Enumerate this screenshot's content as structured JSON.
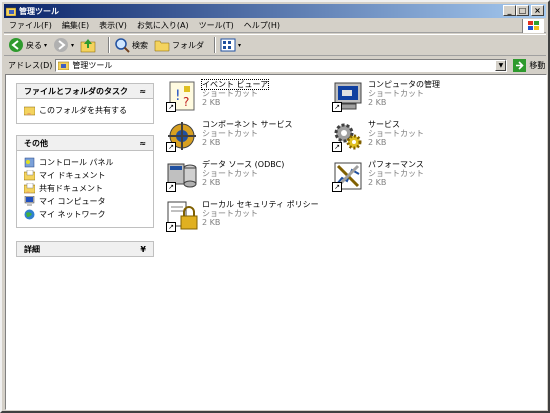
{
  "window": {
    "title": "管理ツール",
    "min": "_",
    "max": "□",
    "close": "×"
  },
  "menu": [
    "ファイル(F)",
    "編集(E)",
    "表示(V)",
    "お気に入り(A)",
    "ツール(T)",
    "ヘルプ(H)"
  ],
  "toolbar": {
    "back": "戻る",
    "search": "検索",
    "folders": "フォルダ"
  },
  "address": {
    "label": "アドレス(D)",
    "value": "管理ツール",
    "go": "移動"
  },
  "tasks": {
    "file_tasks": {
      "title": "ファイルとフォルダのタスク",
      "chev": "≈",
      "items": [
        "このフォルダを共有する"
      ]
    },
    "other": {
      "title": "その他",
      "chev": "≈",
      "items": [
        "コントロール パネル",
        "マイ ドキュメント",
        "共有ドキュメント",
        "マイ コンピュータ",
        "マイ ネットワーク"
      ]
    },
    "details": {
      "title": "詳細",
      "chev": "¥"
    }
  },
  "files": [
    {
      "name": "イベント ビューア",
      "type": "ショートカット",
      "size": "2 KB"
    },
    {
      "name": "コンピュータの管理",
      "type": "ショートカット",
      "size": "2 KB"
    },
    {
      "name": "コンポーネント サービス",
      "type": "ショートカット",
      "size": "2 KB"
    },
    {
      "name": "サービス",
      "type": "ショートカット",
      "size": "2 KB"
    },
    {
      "name": "データ ソース (ODBC)",
      "type": "ショートカット",
      "size": "2 KB"
    },
    {
      "name": "パフォーマンス",
      "type": "ショートカット",
      "size": "2 KB"
    },
    {
      "name": "ローカル セキュリティ ポリシー",
      "type": "ショートカット",
      "size": "2 KB"
    }
  ]
}
